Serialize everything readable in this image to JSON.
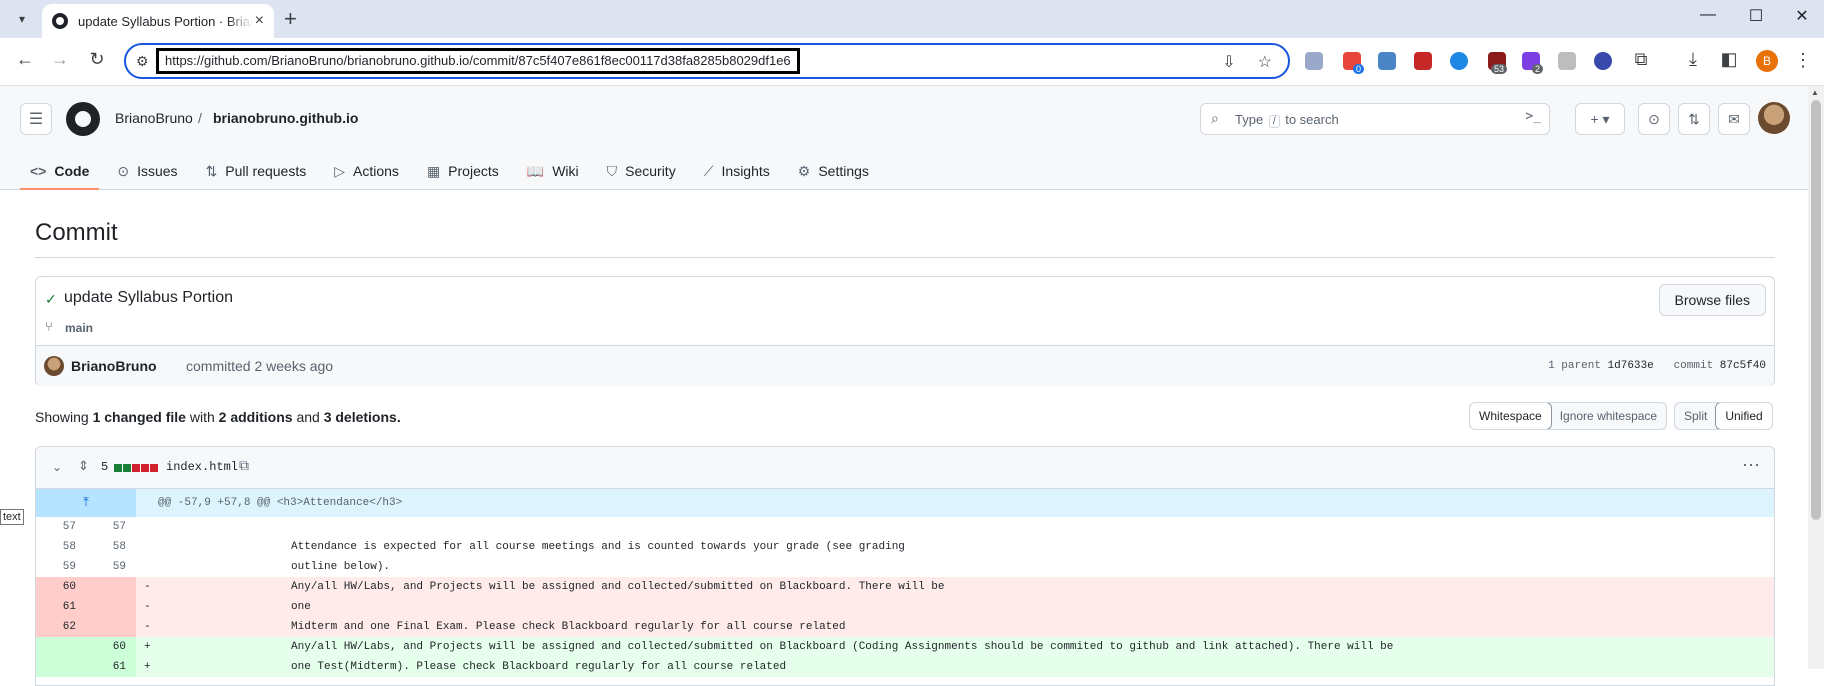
{
  "browser": {
    "tab_title": "update Syllabus Portion · BrianoBruno/brianobruno.github.io",
    "new_tab": "+",
    "url": "https://github.com/BrianoBruno/brianobruno.github.io/commit/87c5f407e861f8ec00117d38fa8285b8029df1e6",
    "profile_initial": "B",
    "ext_badges": [
      "0",
      "53",
      "2"
    ]
  },
  "github": {
    "owner": "BrianoBruno",
    "separator": "/",
    "repo": "brianobruno.github.io",
    "search": {
      "prefix": "Type",
      "key": "/",
      "suffix": "to search",
      "cmd": ">_"
    },
    "nav": [
      {
        "label": "Code",
        "icon": "code-icon",
        "glyph": "<>"
      },
      {
        "label": "Issues",
        "icon": "issue-icon",
        "glyph": "⊙"
      },
      {
        "label": "Pull requests",
        "icon": "pull-request-icon",
        "glyph": "⇅"
      },
      {
        "label": "Actions",
        "icon": "play-icon",
        "glyph": "▷"
      },
      {
        "label": "Projects",
        "icon": "table-icon",
        "glyph": "▦"
      },
      {
        "label": "Wiki",
        "icon": "book-icon",
        "glyph": "📖"
      },
      {
        "label": "Security",
        "icon": "shield-icon",
        "glyph": "⛉"
      },
      {
        "label": "Insights",
        "icon": "graph-icon",
        "glyph": "⟋"
      },
      {
        "label": "Settings",
        "icon": "gear-icon",
        "glyph": "⚙"
      }
    ]
  },
  "commit": {
    "page_title": "Commit",
    "message": "update Syllabus Portion",
    "branch": "main",
    "browse_files": "Browse files",
    "author": "BrianoBruno",
    "when": "committed 2 weeks ago",
    "parent_label": "1 parent",
    "parent_hash": "1d7633e",
    "commit_label": "commit",
    "commit_hash": "87c5f40"
  },
  "summary": {
    "showing": "Showing",
    "files": "1 changed file",
    "with": "with",
    "additions": "2 additions",
    "and": "and",
    "deletions": "3 deletions."
  },
  "view_options": {
    "whitespace": "Whitespace",
    "ignore_whitespace": "Ignore whitespace",
    "split": "Split",
    "unified": "Unified"
  },
  "diff": {
    "count": "5",
    "filename": "index.html",
    "hunk": "@@ -57,9 +57,8 @@ <h3>Attendance</h3>",
    "lines": [
      {
        "type": "ctx",
        "old": "57",
        "new": "57",
        "sign": "",
        "text": ""
      },
      {
        "type": "ctx",
        "old": "58",
        "new": "58",
        "sign": "",
        "text": "Attendance is expected for all course meetings and is counted towards your grade (see grading"
      },
      {
        "type": "ctx",
        "old": "59",
        "new": "59",
        "sign": "",
        "text": "outline below)."
      },
      {
        "type": "del",
        "old": "60",
        "new": "",
        "sign": "-",
        "text": "Any/all HW/Labs, and Projects will be assigned and collected/submitted on Blackboard. There will be"
      },
      {
        "type": "del",
        "old": "61",
        "new": "",
        "sign": "-",
        "text": "one"
      },
      {
        "type": "del",
        "old": "62",
        "new": "",
        "sign": "-",
        "text": "Midterm and one Final Exam. Please check Blackboard regularly for all course related"
      },
      {
        "type": "add",
        "old": "",
        "new": "60",
        "sign": "+",
        "text": "Any/all HW/Labs, and Projects will be assigned and collected/submitted on Blackboard (Coding Assignments should be commited to github and link attached). There will be"
      },
      {
        "type": "add",
        "old": "",
        "new": "61",
        "sign": "+",
        "text": "one Test(Midterm). Please check Blackboard regularly for all course related"
      }
    ]
  },
  "tooltip": "text",
  "colors": {
    "added": "#1a7f37",
    "deleted": "#cf222e",
    "active_tab_underline": "#fd8c73",
    "omnibox_focus": "#1a56db"
  }
}
